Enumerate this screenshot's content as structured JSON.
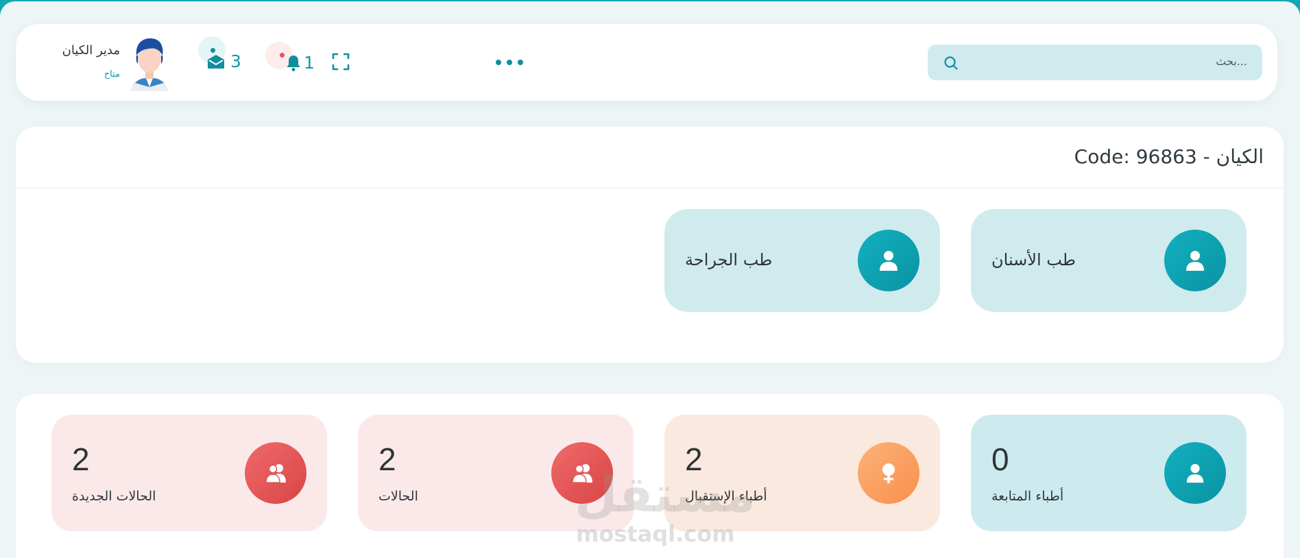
{
  "header": {
    "search_placeholder": "بحث...",
    "notifications_count": "1",
    "messages_count": "3",
    "user_name": "مدير الكيان",
    "user_status": "متاح"
  },
  "entity": {
    "title": "الكيان - Code: 96863"
  },
  "specialties": [
    {
      "label": "طب الأسنان",
      "icon": "user-icon"
    },
    {
      "label": "طب الجراحة",
      "icon": "user-icon"
    }
  ],
  "stats": [
    {
      "value": "0",
      "label": "أطباء المتابعة",
      "icon": "user-icon",
      "color": "#0f9aaa"
    },
    {
      "value": "2",
      "label": "أطباء الإستقبال",
      "icon": "female-icon",
      "color": "#f98f4c"
    },
    {
      "value": "2",
      "label": "الحالات",
      "icon": "users-icon",
      "color": "#d84545"
    },
    {
      "value": "2",
      "label": "الحالات الجديدة",
      "icon": "users-icon",
      "color": "#d84545"
    }
  ],
  "watermark": {
    "arabic": "مستقل",
    "latin": "mostaql.com"
  }
}
